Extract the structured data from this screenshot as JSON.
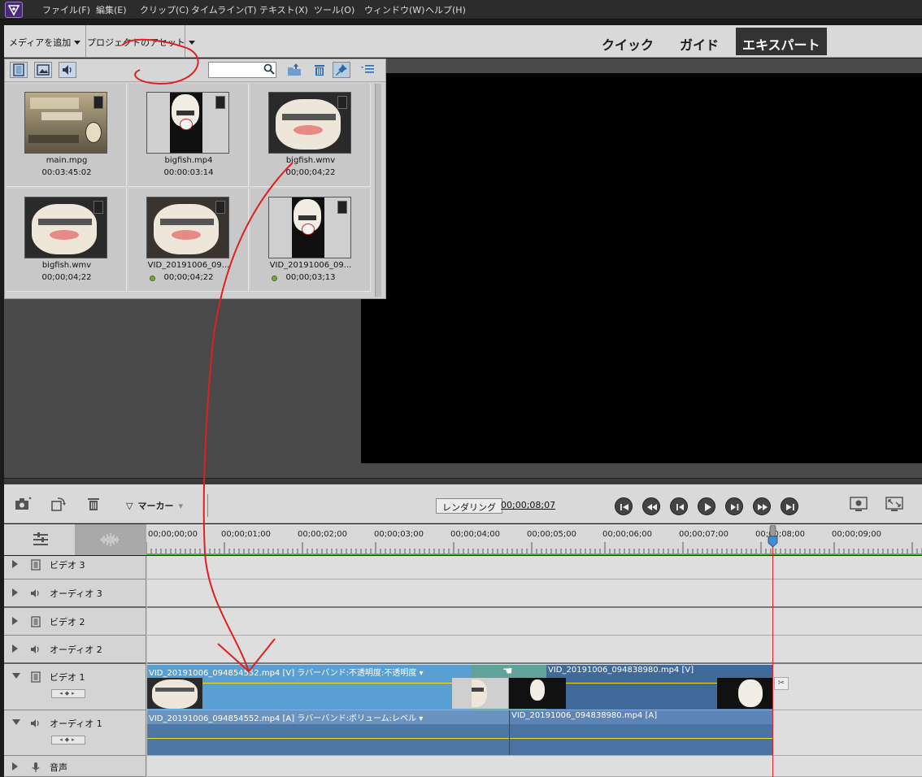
{
  "menu": {
    "items": [
      "ファイル(F)",
      "編集(E)",
      "クリップ(C)",
      "タイムライン(T)",
      "テキスト(X)",
      "ツール(O)",
      "ウィンドウ(W)",
      "ヘルプ(H)"
    ]
  },
  "modebar": {
    "add_media": "メディアを追加",
    "project_assets": "プロジェクトのアセット",
    "tabs": [
      "クイック",
      "ガイド",
      "エキスパート"
    ],
    "active_tab": "エキスパート"
  },
  "assets": {
    "search_value": "",
    "items": [
      {
        "name": "main.mpg",
        "duration": "00:03:45:02",
        "online_dot": false
      },
      {
        "name": "bigfish.mp4",
        "duration": "00:00:03:14",
        "online_dot": false
      },
      {
        "name": "bigfish.wmv",
        "duration": "00;00;04;22",
        "online_dot": false
      },
      {
        "name": "bigfish.wmv",
        "duration": "00;00;04;22",
        "online_dot": false
      },
      {
        "name": "VID_20191006_09...",
        "duration": "00;00;04;22",
        "online_dot": true
      },
      {
        "name": "VID_20191006_09...",
        "duration": "00;00;03;13",
        "online_dot": true
      }
    ]
  },
  "timeline_toolbar": {
    "marker_label": "マーカー",
    "render_label": "レンダリング",
    "timecode": "00;00;08;07"
  },
  "ruler": {
    "labels": [
      "00;00;00;00",
      "00;00;01;00",
      "00;00;02;00",
      "00;00;03;00",
      "00;00;04;00",
      "00;00;05;00",
      "00;00;06;00",
      "00;00;07;00",
      "00;00;08;00",
      "00;00;09;00"
    ]
  },
  "tracks": [
    {
      "name": "ビデオ 3",
      "type": "video",
      "expanded": false
    },
    {
      "name": "オーディオ 3",
      "type": "audio",
      "expanded": false
    },
    {
      "name": "ビデオ 2",
      "type": "video",
      "expanded": false
    },
    {
      "name": "オーディオ 2",
      "type": "audio",
      "expanded": false
    },
    {
      "name": "ビデオ 1",
      "type": "video",
      "expanded": true
    },
    {
      "name": "オーディオ 1",
      "type": "audio",
      "expanded": true
    },
    {
      "name": "音声",
      "type": "narration",
      "expanded": false
    }
  ],
  "clips": {
    "video1_a": "VID_20191006_094854552.mp4 [V] ラバーバンド:不透明度:不透明度 ▾",
    "video1_b": "VID_20191006_094838980.mp4 [V]",
    "audio1_a": "VID_20191006_094854552.mp4 [A] ラバーバンド:ボリューム:レベル ▾",
    "audio1_b": "VID_20191006_094838980.mp4 [A]"
  },
  "colors": {
    "annotation": "#e02020",
    "clip_video_a": "#5a9fd4",
    "clip_video_b": "#3f6a99",
    "clip_audio": "#6a93c0",
    "transition": "#5fa39a",
    "active_tab_bg": "#333333"
  }
}
